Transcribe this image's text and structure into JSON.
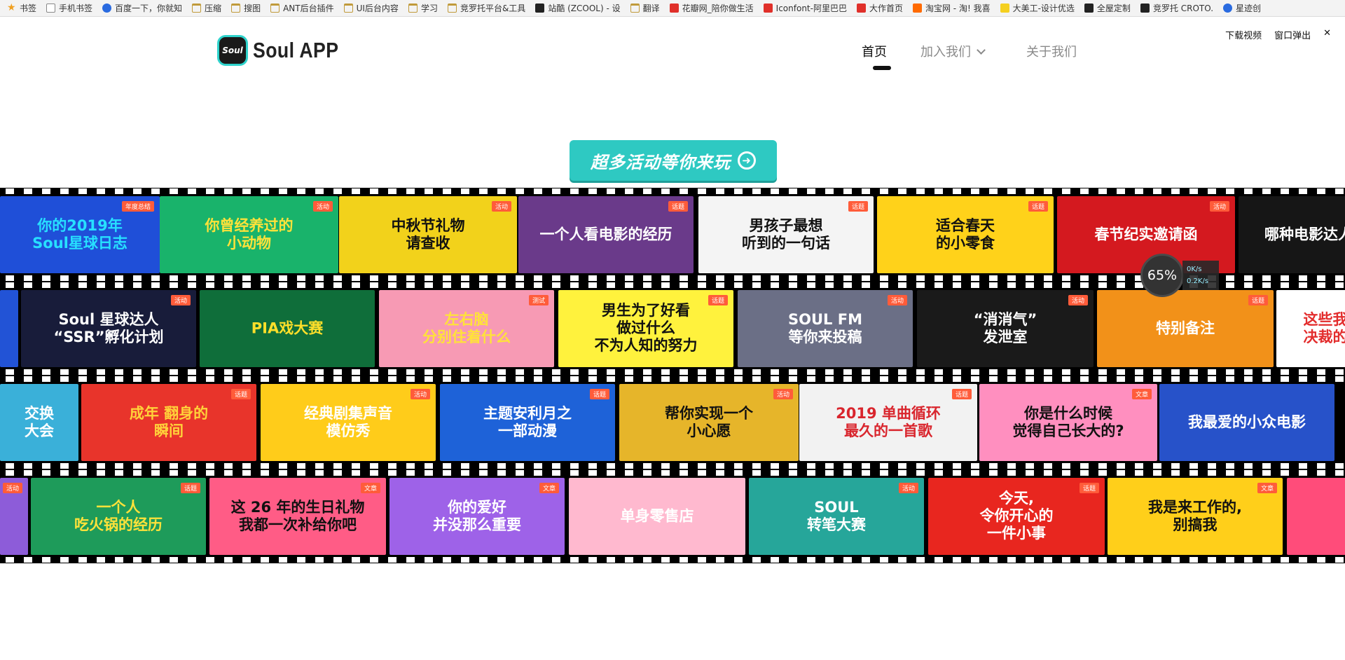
{
  "bookmarks": [
    {
      "label": "书签",
      "icon": "star-icon"
    },
    {
      "label": "手机书签",
      "icon": "page-icon"
    },
    {
      "label": "百度一下，你就知",
      "icon": "baidu-icon"
    },
    {
      "label": "压缩",
      "icon": "folder-icon"
    },
    {
      "label": "搜图",
      "icon": "folder-icon"
    },
    {
      "label": "ANT后台插件",
      "icon": "folder-icon"
    },
    {
      "label": "UI后台内容",
      "icon": "folder-icon"
    },
    {
      "label": "学习",
      "icon": "folder-icon"
    },
    {
      "label": "竞罗托平台&工具",
      "icon": "folder-icon"
    },
    {
      "label": "站酷 (ZCOOL) - 设",
      "icon": "zcool-icon"
    },
    {
      "label": "翻译",
      "icon": "folder-icon"
    },
    {
      "label": "花瓣网_陪你做生活",
      "icon": "huaban-icon"
    },
    {
      "label": "Iconfont-阿里巴巴",
      "icon": "iconfont-icon"
    },
    {
      "label": "大作首页",
      "icon": "dazuo-icon"
    },
    {
      "label": "淘宝网 - 淘! 我喜",
      "icon": "taobao-icon"
    },
    {
      "label": "大美工-设计优选",
      "icon": "dameigong-icon"
    },
    {
      "label": "全屋定制",
      "icon": "c-icon"
    },
    {
      "label": "竞罗托 CROTO.",
      "icon": "c-icon"
    },
    {
      "label": "星迹创",
      "icon": "globe-icon"
    }
  ],
  "header": {
    "logo_mark": "Soul",
    "logo_text": "Soul APP",
    "nav": [
      {
        "label": "首页",
        "active": true
      },
      {
        "label": "加入我们",
        "active": false
      },
      {
        "label": "关于我们",
        "active": false
      }
    ],
    "video_controls": [
      "下载视频",
      "窗口弹出",
      "✕"
    ]
  },
  "cta": {
    "label": "超多活动等你来玩",
    "arrow": "➜"
  },
  "strips": [
    {
      "cards": [
        {
          "text": "你的2019年\nSoul星球日志",
          "bg": "#1f4fd8",
          "fg": "#27e0ff",
          "tag": "年度总结"
        },
        {
          "text": "你曾经养过的\n小动物",
          "bg": "#19b36b",
          "fg": "#ffe23a",
          "tag": "活动"
        },
        {
          "text": "中秋节礼物\n请查收",
          "bg": "#f2d21b",
          "fg": "#111",
          "tag": "活动"
        },
        {
          "text": "一个人看电影的经历",
          "bg": "#6a3a8a",
          "fg": "#fff",
          "tag": "话题"
        },
        {
          "text": "男孩子最想\n听到的一句话",
          "bg": "#f4f4f4",
          "fg": "#111",
          "tag": "话题"
        },
        {
          "text": "适合春天\n的小零食",
          "bg": "#ffd21a",
          "fg": "#111",
          "tag": "话题"
        },
        {
          "text": "春节纪实邀请函",
          "bg": "#d4191f",
          "fg": "#fff",
          "tag": "活动"
        },
        {
          "text": "哪种电影达人",
          "bg": "#161616",
          "fg": "#fff",
          "tag": ""
        }
      ]
    },
    {
      "cards": [
        {
          "text": "",
          "bg": "#2253d6",
          "fg": "#fff",
          "tag": ""
        },
        {
          "text": "Soul 星球达人\n“SSR”孵化计划",
          "bg": "#181c3a",
          "fg": "#fff",
          "tag": "活动"
        },
        {
          "text": "PIA戏大赛",
          "bg": "#0f6e3a",
          "fg": "#ffdf2a",
          "tag": ""
        },
        {
          "text": "左右脑\n分别住着什么",
          "bg": "#f79ab4",
          "fg": "#ffe23a",
          "tag": "测试"
        },
        {
          "text": "男生为了好看\n做过什么\n不为人知的努力",
          "bg": "#fff23d",
          "fg": "#111",
          "tag": "话题"
        },
        {
          "text": "SOUL FM\n等你来投稿",
          "bg": "#6b6f86",
          "fg": "#fff",
          "tag": "活动"
        },
        {
          "text": "“消消气”\n发泄室",
          "bg": "#1a1a1a",
          "fg": "#fff",
          "tag": "活动"
        },
        {
          "text": "特别备注",
          "bg": "#f29119",
          "fg": "#fff",
          "tag": "话题"
        },
        {
          "text": "这些我\n决裁的",
          "bg": "#fff",
          "fg": "#e32d2d",
          "tag": ""
        }
      ]
    },
    {
      "cards": [
        {
          "text": "交换\n大会",
          "bg": "#3ab0d9",
          "fg": "#fff",
          "tag": ""
        },
        {
          "text": "成年 翻身的\n瞬间",
          "bg": "#e8342b",
          "fg": "#ffd23a",
          "tag": "话题"
        },
        {
          "text": "经典剧集声音\n模仿秀",
          "bg": "#ffcc1a",
          "fg": "#fff",
          "tag": "活动"
        },
        {
          "text": "主题安利月之\n一部动漫",
          "bg": "#1e62d8",
          "fg": "#fff",
          "tag": "话题"
        },
        {
          "text": "帮你实现一个\n小心愿",
          "bg": "#e6b52a",
          "fg": "#111",
          "tag": "活动"
        },
        {
          "text": "2019 单曲循环\n最久的一首歌",
          "bg": "#f2f2f2",
          "fg": "#d9252d",
          "tag": "话题"
        },
        {
          "text": "你是什么时候\n觉得自己长大的?",
          "bg": "#ff8fbf",
          "fg": "#111",
          "tag": "文章"
        },
        {
          "text": "我最爱的小众电影",
          "bg": "#2752c9",
          "fg": "#fff",
          "tag": ""
        }
      ]
    },
    {
      "cards": [
        {
          "text": "",
          "bg": "#8d5cd9",
          "fg": "#fff",
          "tag": "活动"
        },
        {
          "text": "一个人\n吃火锅的经历",
          "bg": "#1e9b5a",
          "fg": "#ffe23a",
          "tag": "话题"
        },
        {
          "text": "这 26 年的生日礼物\n我都一次补给你吧",
          "bg": "#ff5c86",
          "fg": "#111",
          "tag": "文章"
        },
        {
          "text": "你的爱好\n并没那么重要",
          "bg": "#9e62e8",
          "fg": "#fff",
          "tag": "文章"
        },
        {
          "text": "单身零售店",
          "bg": "#ffb9cf",
          "fg": "#fff",
          "tag": ""
        },
        {
          "text": "SOUL\n转笔大赛",
          "bg": "#26a69a",
          "fg": "#fff",
          "tag": "活动"
        },
        {
          "text": "今天,\n令你开心的\n一件小事",
          "bg": "#e8261f",
          "fg": "#fff",
          "tag": "话题"
        },
        {
          "text": "我是来工作的,\n别搞我",
          "bg": "#ffcf1a",
          "fg": "#111",
          "tag": "文章"
        },
        {
          "text": "",
          "bg": "#ff4c7a",
          "fg": "#fff",
          "tag": ""
        }
      ]
    }
  ],
  "speed_widget": {
    "percent": "65%",
    "up": "0K/s",
    "down": "0.2K/s"
  }
}
